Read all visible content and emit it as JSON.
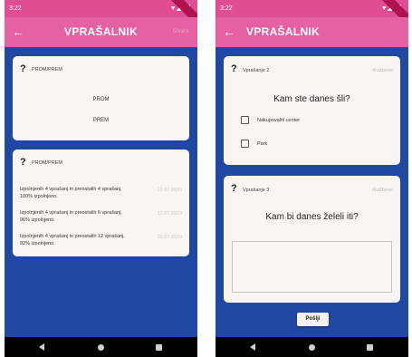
{
  "left_screen": {
    "status_time": "3:22",
    "title": "VPRAŠALNIK",
    "action": "Shrani",
    "card1": {
      "title": "PROM/PREM",
      "options": [
        "PROM",
        "PREM"
      ]
    },
    "card2": {
      "title": "PROM/PREM",
      "rows": [
        {
          "text": "Izpolnjenih 4 vprašanj in preostalih 4 vprašanj. 100% izpolnjeno.",
          "date": "12.07.2020"
        },
        {
          "text": "Izpolnjenih 4 vprašanj in preostalih 6 vprašanj. 96% izpolnjeno.",
          "date": "11.07.2020"
        },
        {
          "text": "Izpolnjenih 4 vprašanj in preostalih 12 vprašanj. 92% izpolnjeno.",
          "date": "10.07.2020"
        }
      ]
    }
  },
  "right_screen": {
    "status_time": "3:22",
    "title": "VPRAŠALNIK",
    "q2": {
      "label": "Vprašanje 2",
      "category": "družbeno",
      "question": "Kam ste danes šli?",
      "options": [
        "Nakupovalni center",
        "Park"
      ]
    },
    "q3": {
      "label": "Vprašanje 3",
      "category": "družbeno",
      "question": "Kam bi danes želeli iti?",
      "answer": ""
    },
    "submit_label": "Pošlji"
  },
  "colors": {
    "status_bar": "#e14d93",
    "app_bar": "#e660a4",
    "background": "#1f48a3",
    "card": "#fbf5f2"
  }
}
